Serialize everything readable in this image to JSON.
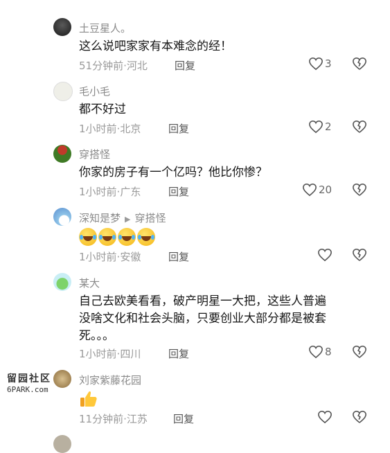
{
  "comments": [
    {
      "username": "土豆星人。",
      "text": "这么说吧家家有本难念的经！",
      "time": "51分钟前",
      "location": "河北",
      "reply_label": "回复",
      "likes": "3",
      "avatar_color": "#2a2a2a"
    },
    {
      "username": "毛小毛",
      "text": "都不好过",
      "time": "1小时前",
      "location": "北京",
      "reply_label": "回复",
      "likes": "2",
      "avatar_color": "#e8e8e0"
    },
    {
      "username": "穿搭怪",
      "text": "你家的房子有一个亿吗？他比你惨？",
      "time": "1小时前",
      "location": "广东",
      "reply_label": "回复",
      "likes": "20",
      "avatar_color": "#4a7a2a"
    },
    {
      "username": "深知是梦",
      "reply_to": "穿搭怪",
      "emoji": "laugh-cry x4",
      "time": "1小时前",
      "location": "安徽",
      "reply_label": "回复",
      "likes": "",
      "avatar_color": "#8fc4e8"
    },
    {
      "username": "某大",
      "text_lines": [
        "自己去欧美看看，破产明星一大把，这些人普遍",
        "没啥文化和社会头脑，只要创业大部分都是被套",
        "死。。。"
      ],
      "time": "1小时前",
      "location": "四川",
      "reply_label": "回复",
      "likes": "8",
      "avatar_color": "#7dd36a"
    },
    {
      "username": "刘家紫藤花园",
      "emoji": "thumbs-up",
      "time": "11分钟前",
      "location": "江苏",
      "reply_label": "回复",
      "likes": "",
      "avatar_color": "#c8a870"
    }
  ],
  "separator": "·",
  "watermark": {
    "top": "留园社区",
    "bottom": "6PARK.com"
  },
  "icons": {
    "like": "heart-outline-icon",
    "dislike": "broken-heart-icon"
  }
}
